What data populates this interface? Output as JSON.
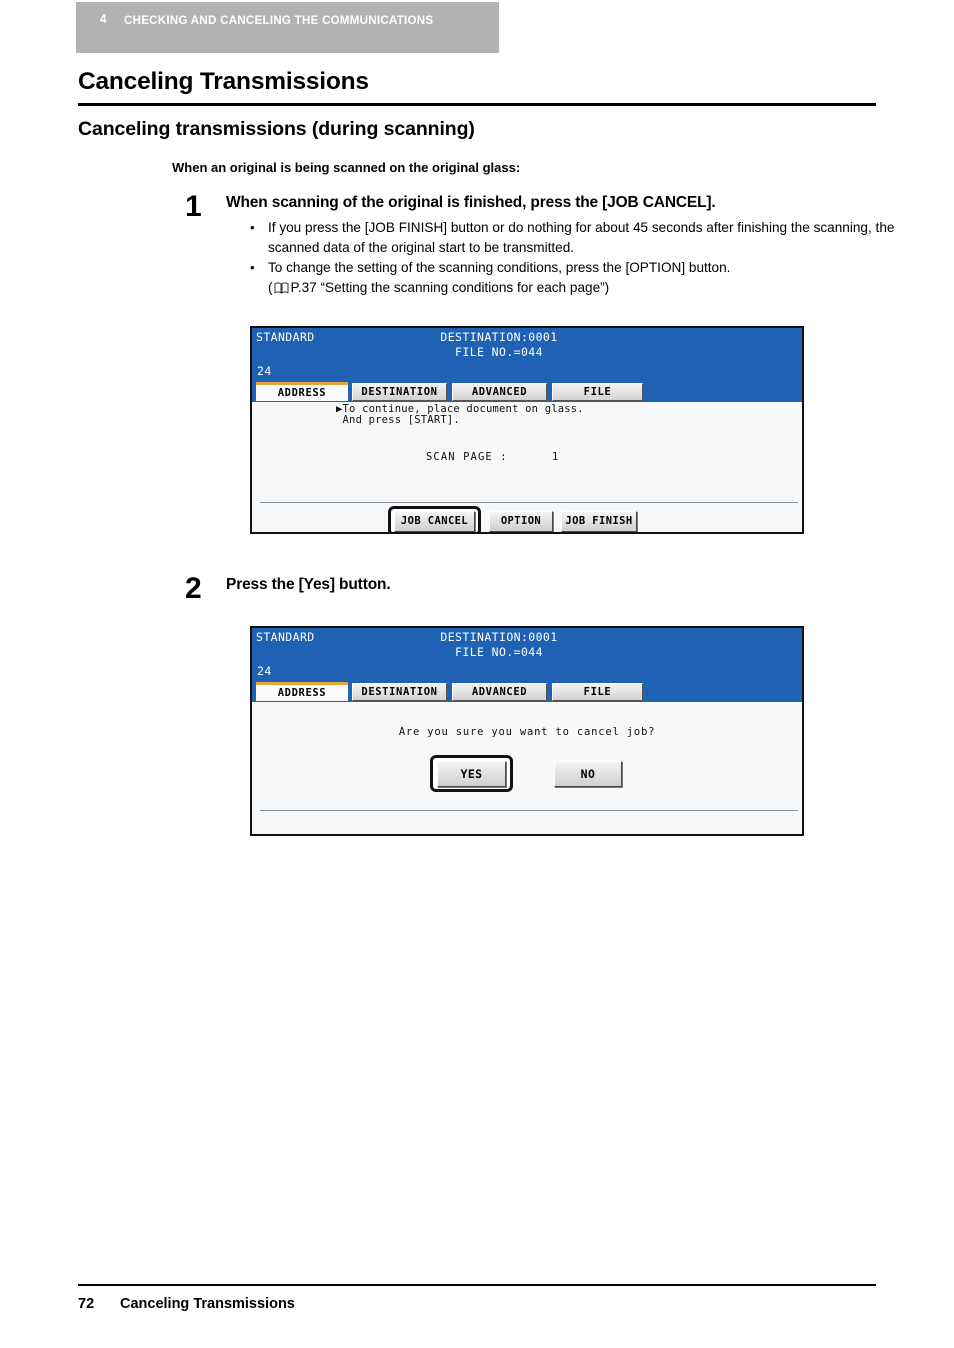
{
  "chapter": {
    "number": "4",
    "title": "CHECKING AND CANCELING THE COMMUNICATIONS"
  },
  "headings": {
    "h1": "Canceling Transmissions",
    "h2": "Canceling transmissions (during scanning)",
    "lead_note": "When an original is being scanned on the original glass:"
  },
  "steps": [
    {
      "number": "1",
      "heading": "When scanning of the original is finished, press the [JOB CANCEL].",
      "bullets": [
        {
          "marker": "•",
          "text": "If you press the [JOB FINISH] button or do nothing for about 45 seconds after finishing the scanning, the scanned data of the original start to be transmitted."
        },
        {
          "marker": "•",
          "text": "To change the setting of the scanning conditions, press the [OPTION] button."
        }
      ],
      "reference": {
        "open_paren": "(",
        "icon": "book-icon",
        "text": "P.37 “Setting the scanning conditions for each page”)"
      }
    },
    {
      "number": "2",
      "heading": "Press the [Yes] button."
    }
  ],
  "lcd_screens": [
    {
      "name": "scan-in-progress",
      "header": {
        "mode": "STANDARD",
        "destination": "DESTINATION:0001",
        "file_no": "FILE NO.=044",
        "counter": "24"
      },
      "tabs": [
        {
          "label": "ADDRESS",
          "active": true
        },
        {
          "label": "DESTINATION",
          "active": false
        },
        {
          "label": "ADVANCED",
          "active": false
        },
        {
          "label": "FILE",
          "active": false
        }
      ],
      "message_line1": "▶To continue, place document on glass.",
      "message_line2": " And press [START].",
      "scan_page_label": "SCAN PAGE :",
      "scan_page_value": "1",
      "buttons": [
        {
          "label": "JOB CANCEL",
          "focused": true
        },
        {
          "label": "OPTION",
          "focused": false
        },
        {
          "label": "JOB FINISH",
          "focused": false
        }
      ]
    },
    {
      "name": "cancel-confirmation",
      "header": {
        "mode": "STANDARD",
        "destination": "DESTINATION:0001",
        "file_no": "FILE NO.=044",
        "counter": "24"
      },
      "tabs": [
        {
          "label": "ADDRESS",
          "active": true
        },
        {
          "label": "DESTINATION",
          "active": false
        },
        {
          "label": "ADVANCED",
          "active": false
        },
        {
          "label": "FILE",
          "active": false
        }
      ],
      "prompt": "Are you sure you want to cancel job?",
      "buttons": [
        {
          "label": "YES",
          "focused": true
        },
        {
          "label": "NO",
          "focused": false
        }
      ]
    }
  ],
  "footer": {
    "page_number": "72",
    "title": "Canceling Transmissions"
  },
  "colors": {
    "lcd_header_blue": "#1f62b4",
    "banner_gray": "#b3b3b3",
    "active_tab_accent": "#e8a33d"
  }
}
